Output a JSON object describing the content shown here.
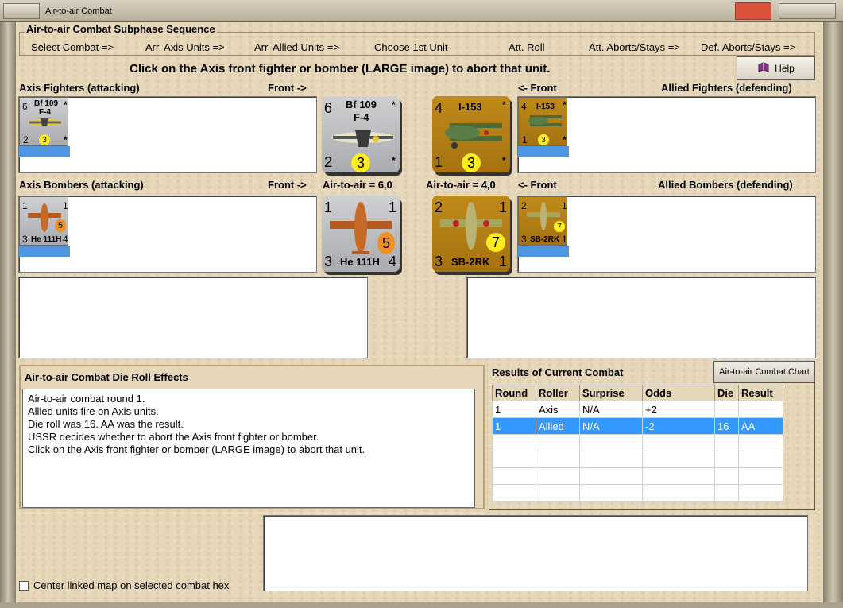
{
  "window": {
    "title": "Air-to-air Combat"
  },
  "sequence": {
    "title": "Air-to-air Combat Subphase Sequence",
    "steps": [
      "Select Combat =>",
      "Arr. Axis Units =>",
      "Arr. Allied Units =>",
      "Choose 1st Unit",
      "Att. Roll",
      "Att. Aborts/Stays =>",
      "Def. Aborts/Stays =>"
    ]
  },
  "instruction": "Click on the Axis front fighter or bomber  (LARGE image) to abort that unit.",
  "help_label": "Help",
  "headers": {
    "axis_fighters": "Axis Fighters (attacking)",
    "front_right": "Front ->",
    "front_left": "<- Front",
    "allied_fighters": "Allied Fighters (defending)",
    "axis_bombers": "Axis Bombers (attacking)",
    "front_right_2": "Front ->",
    "axis_a2a": "Air-to-air = 6,0",
    "allied_a2a": "Air-to-air = 4,0",
    "front_left_2": "<- Front",
    "allied_bombers": "Allied Bombers (defending)"
  },
  "units": {
    "axis_fighter": {
      "name": "Bf 109",
      "model": "F-4",
      "top_left": "6",
      "top_right": "*",
      "bottom_left": "2",
      "circle": "3",
      "bottom_right": "*"
    },
    "allied_fighter": {
      "name": "I-153",
      "top_left": "4",
      "top_right": "*",
      "bottom_left": "1",
      "circle": "3",
      "bottom_right": "*"
    },
    "axis_bomber": {
      "name": "He 111H",
      "top_left": "1",
      "top_right": "1",
      "bottom_left": "3",
      "circle": "5",
      "bottom_right": "4"
    },
    "allied_bomber": {
      "name": "SB-2RK",
      "top_left": "2",
      "top_right": "1",
      "bottom_left": "3",
      "circle": "7",
      "bottom_right": "1"
    }
  },
  "die_roll_effects": {
    "title": "Air-to-air Combat Die Roll Effects",
    "lines": [
      "Air-to-air combat round 1.",
      "Allied units fire on Axis units.",
      "Die roll was 16.  AA was the result.",
      "USSR decides whether to abort the Axis front fighter or bomber.",
      "Click on the Axis front fighter or bomber  (LARGE image) to abort that unit."
    ]
  },
  "results": {
    "title": "Results of Current Combat",
    "chart_button": "Air-to-air Combat Chart",
    "columns": [
      "Round",
      "Roller",
      "Surprise",
      "Odds",
      "Die",
      "Result"
    ],
    "rows": [
      [
        "1",
        "Axis",
        "N/A",
        "+2",
        "",
        ""
      ],
      [
        "1",
        "Allied",
        "N/A",
        "-2",
        "16",
        "AA"
      ]
    ]
  },
  "center_map_label": "Center linked map on selected combat hex",
  "colors": {
    "allied_unit": "#b07c14",
    "axis_unit": "#b9babd",
    "selection": "#3399ff"
  }
}
